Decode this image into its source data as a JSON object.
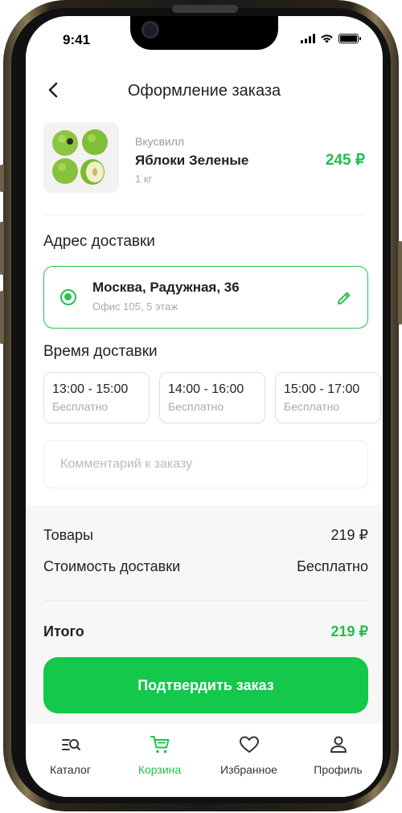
{
  "status_bar": {
    "time": "9:41"
  },
  "header": {
    "title": "Оформление заказа"
  },
  "product": {
    "vendor": "Вкусвилл",
    "name": "Яблоки Зеленые",
    "weight": "1 кг",
    "price": "245 ₽",
    "image_icon": "green-apples-image"
  },
  "address": {
    "section_title": "Адрес доставки",
    "main": "Москва, Радужная, 36",
    "sub": "Офис 105, 5 этаж",
    "selected": true
  },
  "delivery_time": {
    "section_title": "Время доставки",
    "slots": [
      {
        "time": "13:00 - 15:00",
        "price": "Бесплатно"
      },
      {
        "time": "14:00 - 16:00",
        "price": "Бесплатно"
      },
      {
        "time": "15:00 - 17:00",
        "price": "Бесплатно"
      }
    ]
  },
  "comment": {
    "placeholder": "Комментарий к заказу",
    "value": ""
  },
  "summary": {
    "goods_label": "Товары",
    "goods_value": "219 ₽",
    "delivery_label": "Стоимость доставки",
    "delivery_value": "Бесплатно",
    "total_label": "Итого",
    "total_value": "219 ₽"
  },
  "confirm_button": {
    "label": "Подтвердить заказ"
  },
  "tabbar": {
    "items": [
      {
        "label": "Каталог",
        "icon": "catalog-search-icon",
        "active": false
      },
      {
        "label": "Корзина",
        "icon": "cart-icon",
        "active": true
      },
      {
        "label": "Избранное",
        "icon": "heart-icon",
        "active": false
      },
      {
        "label": "Профиль",
        "icon": "profile-icon",
        "active": false
      }
    ]
  },
  "colors": {
    "accent": "#13c84a",
    "price_green": "#1fbf4b",
    "text": "#222222",
    "muted": "#aaaaaa"
  }
}
